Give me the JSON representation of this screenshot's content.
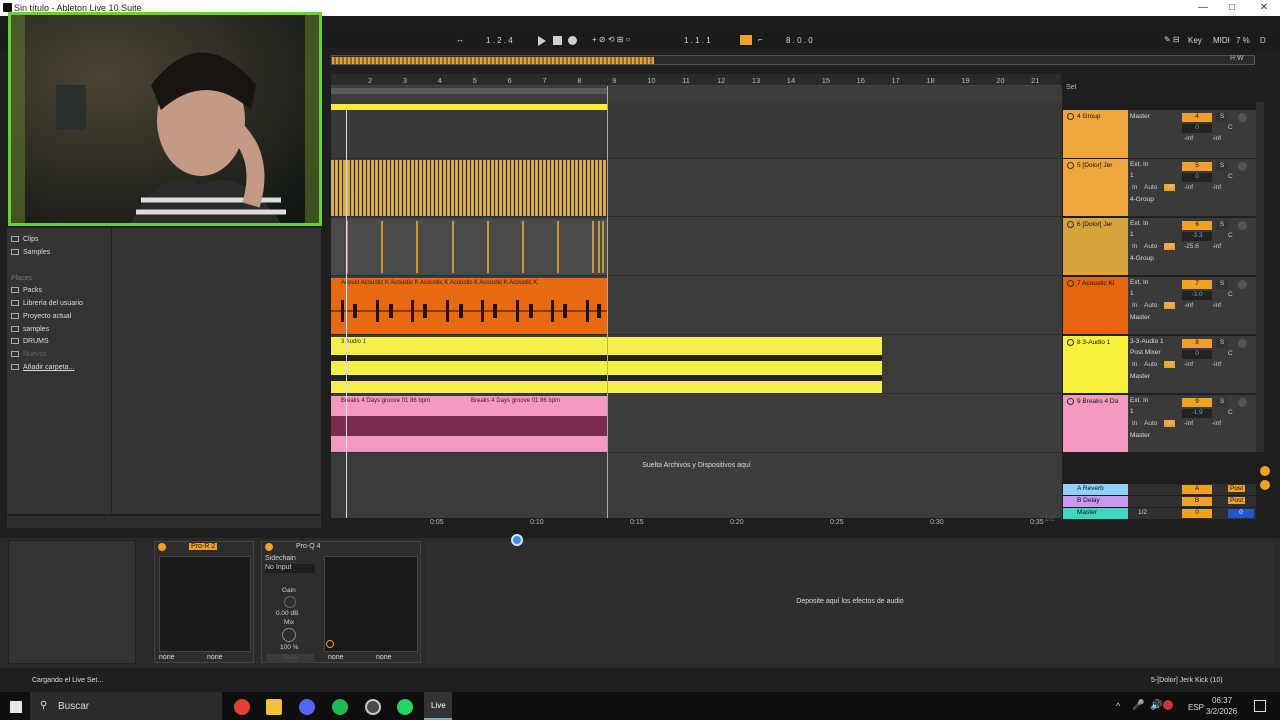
{
  "window": {
    "title": "Sin título - Ableton Live 10 Suite"
  },
  "transport": {
    "nudge": "1 . 2 . 4",
    "position": "1 . 1 . 1",
    "loop_length": "8 . 0 . 0",
    "key_label": "Key",
    "midi_label": "MIDI",
    "cpu": "7 %",
    "d_label": "D"
  },
  "ruler": {
    "bars": [
      "2",
      "3",
      "4",
      "5",
      "6",
      "7",
      "8",
      "9",
      "10",
      "11",
      "12",
      "13",
      "14",
      "15",
      "16",
      "17",
      "18",
      "19",
      "20",
      "21"
    ]
  },
  "timeline": {
    "marks": [
      "0:05",
      "0:10",
      "0:15",
      "0:20",
      "0:25",
      "0:30",
      "0:35"
    ],
    "zoom": "1/2"
  },
  "clips": {
    "acoustic_label": "Acoust Acoustic K Acoustic K Acoustic K Acoustic K Acoustic K Acoustic K",
    "audio1_label": "3 Audio 1",
    "breaks_label_a": "Breaks 4 Days groove 01 86 bpm",
    "breaks_label_b": "Breaks 4 Days groove 01 86 bpm",
    "drop_hint": "Suelta Archivos y Dispositivos aquí"
  },
  "set_label": "Set",
  "tracks": [
    {
      "name": "4 Group",
      "color": "#f0a63b",
      "routing": "Master",
      "num": "4",
      "vol": "0",
      "pan": "C",
      "l": "-inf",
      "r": "-inf"
    },
    {
      "name": "5 [Dolor] Jer",
      "color": "#f0a63b",
      "input": "Ext. In",
      "ch": "1",
      "routing": "4-Group",
      "num": "5",
      "vol": "0",
      "pan": "C",
      "l": "-inf",
      "r": "-inf"
    },
    {
      "name": "6 [Dolor] Jer",
      "color": "#d6a43a",
      "input": "Ext. In",
      "ch": "1",
      "routing": "4-Group",
      "num": "6",
      "vol": "-3.3",
      "pan": "C",
      "l": "-25.6",
      "r": "-inf"
    },
    {
      "name": "7 Acoustic Ki",
      "color": "#e8650f",
      "input": "Ext. In",
      "ch": "1",
      "routing": "Master",
      "num": "7",
      "vol": "-3.0",
      "pan": "C",
      "l": "-inf",
      "r": "-inf"
    },
    {
      "name": "8 3-Audio 1",
      "color": "#f4f03c",
      "input": "3-3-Audio 1",
      "ch": "Post Mixer",
      "routing": "Master",
      "num": "8",
      "vol": "0",
      "pan": "C",
      "l": "-inf",
      "r": "-inf"
    },
    {
      "name": "9 Breaks 4 Da",
      "color": "#f49ac0",
      "input": "Ext. In",
      "ch": "1",
      "routing": "Master",
      "num": "9",
      "vol": "-1.9",
      "pan": "C",
      "l": "-inf",
      "r": "-inf"
    }
  ],
  "monitor": {
    "in": "In",
    "auto": "Auto",
    "off": "Off"
  },
  "returns": [
    {
      "name": "A Reverb",
      "color": "#8fd0ff",
      "num": "A",
      "post": "Post"
    },
    {
      "name": "B Delay",
      "color": "#c69af0",
      "num": "B",
      "post": "Post"
    },
    {
      "name": "Master",
      "color": "#3dd6c0",
      "num": "0",
      "extra": "1/2",
      "vol": "0"
    }
  ],
  "browser": {
    "top_items": [
      "Clips",
      "Samples"
    ],
    "places_header": "Places",
    "places": [
      "Packs",
      "Librería del usuario",
      "Proyecto actual",
      "samples",
      "DRUMS",
      "Nuevos",
      "Añadir carpeta..."
    ]
  },
  "devices": {
    "proR2": {
      "title": "Pro-R 2",
      "none1": "none",
      "none2": "none"
    },
    "proQ4": {
      "title": "Pro-Q 4",
      "sidechain": "Sidechain",
      "no_input": "No Input",
      "gain": "Gain",
      "gain_val": "0.00 dB",
      "mix": "Mix",
      "mix_val": "100 %",
      "mute": "Mute",
      "none1": "none",
      "none2": "none"
    },
    "drop_hint": "Deposite aquí los efectos de audio"
  },
  "status": {
    "left": "Cargando el Live Set...",
    "right": "5-[Dolor] Jerk Kick (10)"
  },
  "taskbar": {
    "search": "Buscar",
    "live": "Live",
    "lang": "ESP",
    "time": "06:37",
    "date": "3/2/2026"
  }
}
